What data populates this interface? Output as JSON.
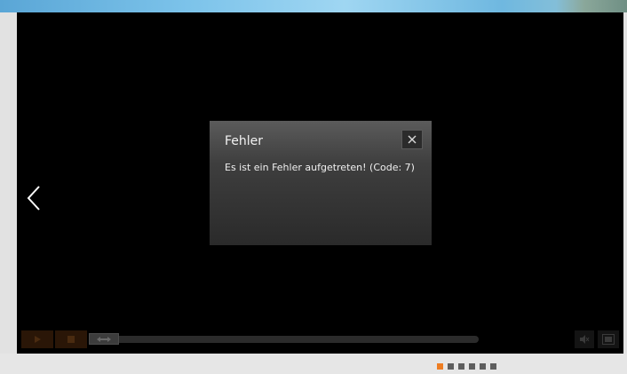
{
  "dialog": {
    "title": "Fehler",
    "message": "Es ist ein Fehler aufgetreten! (Code: 7)",
    "close_icon": "close-icon"
  },
  "player": {
    "prev_icon": "chevron-left-icon",
    "controls": {
      "play_icon": "play-icon",
      "stop_icon": "stop-icon",
      "seek_handle_icon": "arrows-horizontal-icon",
      "mute_icon": "speaker-muted-icon",
      "fullscreen_icon": "fullscreen-icon",
      "progress_fraction": 0
    }
  },
  "pager": {
    "count": 6,
    "active_index": 0
  },
  "colors": {
    "accent": "#ee7d22",
    "dot_inactive": "#5e5e5e",
    "player_bg": "#000000",
    "page_bg": "#e6e6e6"
  }
}
